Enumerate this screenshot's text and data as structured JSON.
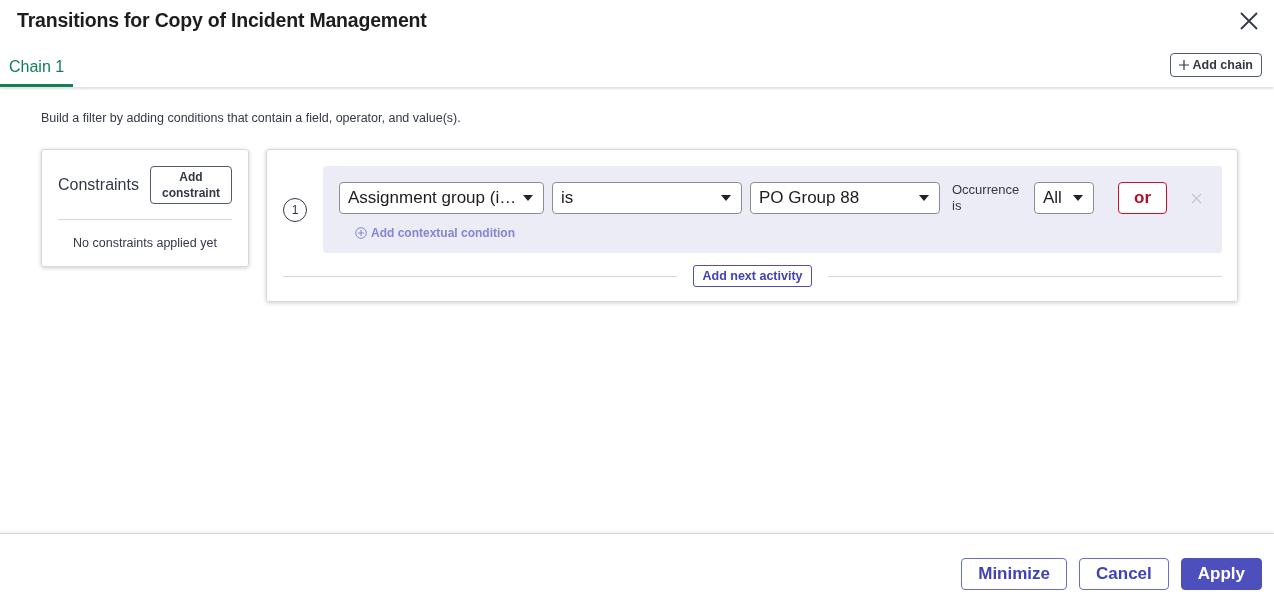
{
  "dialog": {
    "title": "Transitions for Copy of Incident Management"
  },
  "tabs": [
    {
      "label": "Chain 1",
      "selected": true
    }
  ],
  "add_chain": "Add chain",
  "description": "Build a filter by adding conditions that contain a field, operator, and value(s).",
  "constraints": {
    "title": "Constraints",
    "add_button": "Add constraint",
    "empty_text": "No constraints applied yet"
  },
  "activities": [
    {
      "number": "1",
      "field": "Assignment group (i…",
      "operator": "is",
      "value": "PO Group 88",
      "occurrence_label": "Occurrence is",
      "occurrence": "All",
      "or_button": "or",
      "contextual": {
        "label": "Add contextual condition",
        "disabled": true
      }
    }
  ],
  "add_next": "Add next activity",
  "footer_buttons": [
    {
      "label": "Minimize",
      "kind": "secondary"
    },
    {
      "label": "Cancel",
      "kind": "secondary"
    },
    {
      "label": "Apply",
      "kind": "primary"
    }
  ]
}
